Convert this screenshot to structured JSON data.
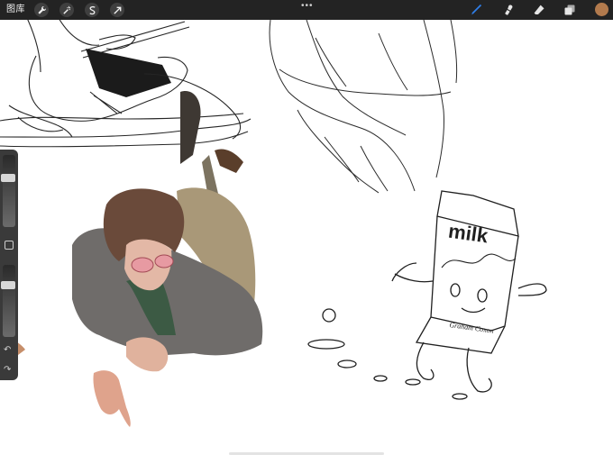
{
  "topbar": {
    "gallery_label": "图库",
    "tools_left": [
      {
        "name": "wrench-icon"
      },
      {
        "name": "magic-wand-icon"
      },
      {
        "name": "selection-s-icon"
      },
      {
        "name": "transform-arrow-icon"
      }
    ],
    "more": "•••",
    "tools_right": [
      {
        "name": "brush-icon",
        "color": "#2f7ee8"
      },
      {
        "name": "smudge-icon",
        "color": "#e6e6e6"
      },
      {
        "name": "eraser-icon",
        "color": "#e6e6e6"
      },
      {
        "name": "layers-icon",
        "color": "#e6e6e6"
      }
    ],
    "current_color": "#b27a4d"
  },
  "sidebar": {
    "brush_size_level": 0.28,
    "opacity_level": 0.32,
    "modify_icon": "square-icon",
    "undo_glyph": "↶",
    "redo_glyph": "↷"
  },
  "canvas": {
    "milk_text": "milk",
    "signature_text": "Graham Coxon"
  },
  "colors": {
    "topbar": "#232323",
    "accent": "#2f7ee8"
  }
}
